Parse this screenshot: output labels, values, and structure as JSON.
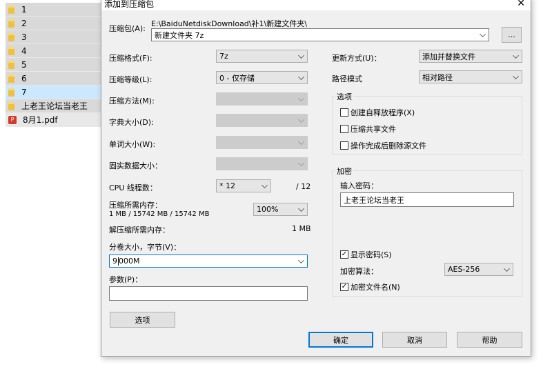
{
  "files": [
    {
      "name": "1"
    },
    {
      "name": "2"
    },
    {
      "name": "3"
    },
    {
      "name": "4"
    },
    {
      "name": "5"
    },
    {
      "name": "6"
    },
    {
      "name": "7"
    },
    {
      "name": "上老王论坛当老王"
    },
    {
      "name": "8月1.pdf"
    }
  ],
  "dialog": {
    "title": "添加到压缩包",
    "archive_label": "压缩包(A):",
    "archive_path": "E:\\BaiduNetdiskDownload\\补1\\新建文件夹\\",
    "archive_name": "新建文件夹 7z",
    "browse": "...",
    "format_label": "压缩格式(F):",
    "format_value": "7z",
    "level_label": "压缩等级(L):",
    "level_value": "0 - 仅存储",
    "method_label": "压缩方法(M):",
    "dict_label": "字典大小(D):",
    "word_label": "单词大小(W):",
    "solid_label": "固实数据大小：",
    "cpu_label": "CPU 线程数：",
    "cpu_value": "* 12",
    "cpu_total": "/ 12",
    "mem_label": "压缩所需内存：",
    "mem_detail": "1 MB / 15742 MB / 15742 MB",
    "mem_percent": "100%",
    "decomp_label": "解压缩所需内存：",
    "decomp_value": "1 MB",
    "volume_label": "分卷大小，字节(V)：",
    "volume_value_a": "9",
    "volume_value_b": "000M",
    "params_label": "参数(P)：",
    "options_button": "选项",
    "update_label": "更新方式(U)：",
    "update_value": "添加并替换文件",
    "path_label": "路径模式",
    "path_value": "相对路径",
    "options_group": "选项",
    "opt_sfx": "创建自释放程序(X)",
    "opt_shared": "压缩共享文件",
    "opt_delete": "操作完成后删除源文件",
    "enc_group": "加密",
    "pwd_label": "输入密码：",
    "pwd_value": "上老王论坛当老王",
    "show_pwd": "显示密码(S)",
    "enc_method_label": "加密算法：",
    "enc_method_value": "AES-256",
    "enc_names": "加密文件名(N)",
    "ok": "确定",
    "cancel": "取消",
    "help": "帮助"
  }
}
